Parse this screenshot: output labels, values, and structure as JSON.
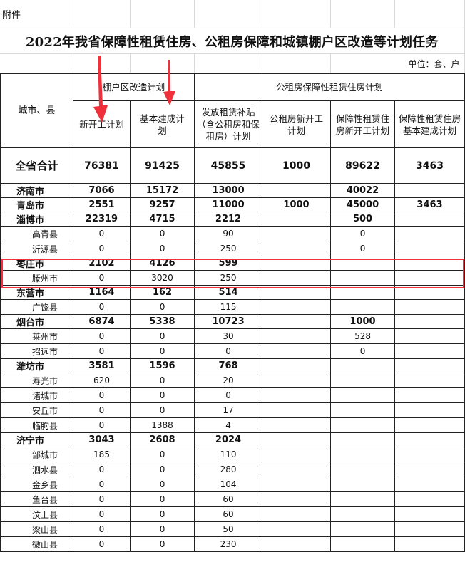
{
  "annex_label": "附件",
  "title": "2022年我省保障性租赁住房、公租房保障和城镇棚户区改造等计划任务",
  "unit": "单位：套、户",
  "header": {
    "city_col": "城市、县",
    "group1": "棚户区改造计划",
    "group2": "公租房保障性租赁住房计划",
    "cols": [
      "新开工计划",
      "基本建成计划",
      "发放租赁补贴（含公租房和保租房）计划",
      "公租房新开工计划",
      "保障性租赁住房新开工计划",
      "保障性租赁住房基本建成计划"
    ]
  },
  "total": {
    "name": "全省合计",
    "values": [
      "76381",
      "91425",
      "45855",
      "1000",
      "89622",
      "3463"
    ]
  },
  "rows": [
    {
      "name": "济南市",
      "level": 1,
      "values": [
        "7066",
        "15172",
        "13000",
        "",
        "40022",
        ""
      ]
    },
    {
      "name": "青岛市",
      "level": 1,
      "values": [
        "2551",
        "9257",
        "11000",
        "1000",
        "45000",
        "3463"
      ]
    },
    {
      "name": "淄博市",
      "level": 1,
      "values": [
        "22319",
        "4715",
        "2212",
        "",
        "500",
        ""
      ]
    },
    {
      "name": "高青县",
      "level": 2,
      "values": [
        "0",
        "0",
        "90",
        "",
        "0",
        ""
      ]
    },
    {
      "name": "沂源县",
      "level": 2,
      "values": [
        "0",
        "0",
        "250",
        "",
        "0",
        ""
      ]
    },
    {
      "name": "枣庄市",
      "level": 1,
      "values": [
        "2102",
        "4126",
        "599",
        "",
        "",
        ""
      ],
      "highlighted": true
    },
    {
      "name": "滕州市",
      "level": 2,
      "values": [
        "0",
        "3020",
        "250",
        "",
        "",
        ""
      ],
      "highlighted": true
    },
    {
      "name": "东营市",
      "level": 1,
      "values": [
        "1164",
        "162",
        "514",
        "",
        "",
        ""
      ]
    },
    {
      "name": "广饶县",
      "level": 2,
      "values": [
        "0",
        "0",
        "115",
        "",
        "",
        ""
      ]
    },
    {
      "name": "烟台市",
      "level": 1,
      "values": [
        "6874",
        "5338",
        "10723",
        "",
        "1000",
        ""
      ]
    },
    {
      "name": "莱州市",
      "level": 2,
      "values": [
        "0",
        "0",
        "30",
        "",
        "528",
        ""
      ]
    },
    {
      "name": "招远市",
      "level": 2,
      "values": [
        "0",
        "0",
        "0",
        "",
        "0",
        ""
      ]
    },
    {
      "name": "潍坊市",
      "level": 1,
      "values": [
        "3581",
        "1596",
        "768",
        "",
        "",
        ""
      ]
    },
    {
      "name": "寿光市",
      "level": 2,
      "values": [
        "620",
        "0",
        "20",
        "",
        "",
        ""
      ]
    },
    {
      "name": "诸城市",
      "level": 2,
      "values": [
        "0",
        "0",
        "0",
        "",
        "",
        ""
      ]
    },
    {
      "name": "安丘市",
      "level": 2,
      "values": [
        "0",
        "0",
        "17",
        "",
        "",
        ""
      ]
    },
    {
      "name": "临朐县",
      "level": 2,
      "values": [
        "0",
        "1388",
        "4",
        "",
        "",
        ""
      ]
    },
    {
      "name": "济宁市",
      "level": 1,
      "values": [
        "3043",
        "2608",
        "2024",
        "",
        "",
        ""
      ]
    },
    {
      "name": "邹城市",
      "level": 2,
      "values": [
        "185",
        "0",
        "110",
        "",
        "",
        ""
      ]
    },
    {
      "name": "泗水县",
      "level": 2,
      "values": [
        "0",
        "0",
        "280",
        "",
        "",
        ""
      ]
    },
    {
      "name": "金乡县",
      "level": 2,
      "values": [
        "0",
        "0",
        "104",
        "",
        "",
        ""
      ]
    },
    {
      "name": "鱼台县",
      "level": 2,
      "values": [
        "0",
        "0",
        "60",
        "",
        "",
        ""
      ]
    },
    {
      "name": "汶上县",
      "level": 2,
      "values": [
        "0",
        "0",
        "60",
        "",
        "",
        ""
      ]
    },
    {
      "name": "梁山县",
      "level": 2,
      "values": [
        "0",
        "0",
        "50",
        "",
        "",
        ""
      ]
    },
    {
      "name": "微山县",
      "level": 2,
      "values": [
        "0",
        "0",
        "230",
        "",
        "",
        ""
      ]
    }
  ],
  "annotations": {
    "highlight_color": "#f0303a",
    "arrow_color": "#f0303a",
    "arrow_targets": [
      "新开工计划",
      "基本建成计划"
    ],
    "highlight_rows": [
      "枣庄市",
      "滕州市"
    ]
  }
}
